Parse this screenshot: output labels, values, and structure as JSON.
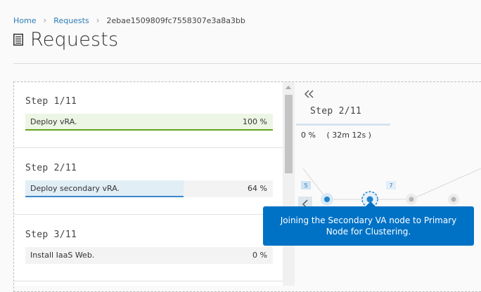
{
  "breadcrumb": {
    "home": "Home",
    "requests": "Requests",
    "current": "2ebae1509809fc7558307e3a8a3bb"
  },
  "page": {
    "title": "Requests"
  },
  "steps": [
    {
      "label": "Step 1/11",
      "name": "Deploy vRA.",
      "percent": "100 %",
      "progress": 100,
      "state": "complete"
    },
    {
      "label": "Step 2/11",
      "name": "Deploy secondary vRA.",
      "percent": "64 %",
      "progress": 64,
      "state": "running"
    },
    {
      "label": "Step 3/11",
      "name": "Install IaaS Web.",
      "percent": "0 %",
      "progress": 0,
      "state": "pending"
    }
  ],
  "detail": {
    "step_label": "Step 2/11",
    "percent": "0 %",
    "elapsed": "( 32m 12s )",
    "node_badges": [
      "5",
      "7"
    ]
  },
  "tooltip": {
    "text": "Joining the Secondary VA node to Primary Node for Clustering."
  },
  "colors": {
    "accent": "#0072c6",
    "success": "#62a420",
    "running": "#3a87c8"
  },
  "icons": {
    "title": "document-icon",
    "collapse": "double-chevron-left-icon",
    "back": "chevron-left-icon"
  }
}
